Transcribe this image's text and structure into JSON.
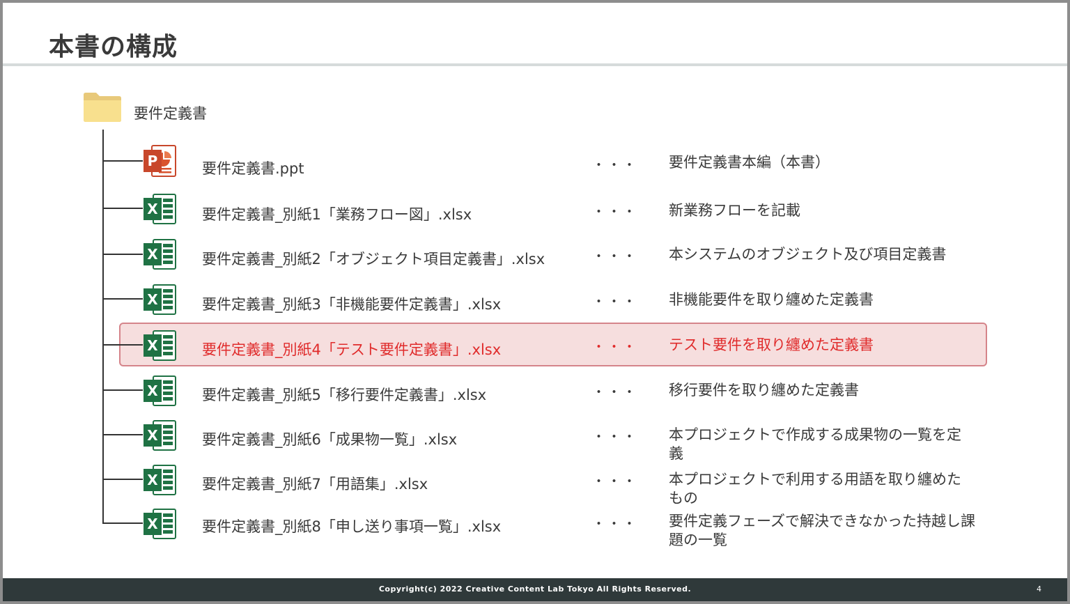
{
  "title": "本書の構成",
  "folder": {
    "label": "要件定義書",
    "icon": "folder-icon"
  },
  "files": [
    {
      "name": "要件定義書.ppt",
      "separator": "・・・",
      "desc": "要件定義書本編（本書）",
      "icon": "powerpoint-icon",
      "highlighted": false
    },
    {
      "name": "要件定義書_別紙1「業務フロー図」.xlsx",
      "separator": "・・・",
      "desc": "新業務フローを記載",
      "icon": "excel-icon",
      "highlighted": false
    },
    {
      "name": "要件定義書_別紙2「オブジェクト項目定義書」.xlsx",
      "separator": "・・・",
      "desc": "本システムのオブジェクト及び項目定義書",
      "icon": "excel-icon",
      "highlighted": false
    },
    {
      "name": "要件定義書_別紙3「非機能要件定義書」.xlsx",
      "separator": "・・・",
      "desc": "非機能要件を取り纏めた定義書",
      "icon": "excel-icon",
      "highlighted": false
    },
    {
      "name": "要件定義書_別紙4「テスト要件定義書」.xlsx",
      "separator": "・・・",
      "desc": "テスト要件を取り纏めた定義書",
      "icon": "excel-icon",
      "highlighted": true
    },
    {
      "name": "要件定義書_別紙5「移行要件定義書」.xlsx",
      "separator": "・・・",
      "desc": "移行要件を取り纏めた定義書",
      "icon": "excel-icon",
      "highlighted": false
    },
    {
      "name": "要件定義書_別紙6「成果物一覧」.xlsx",
      "separator": "・・・",
      "desc": "本プロジェクトで作成する成果物の一覧を定義",
      "icon": "excel-icon",
      "highlighted": false
    },
    {
      "name": "要件定義書_別紙7「用語集」.xlsx",
      "separator": "・・・",
      "desc": "本プロジェクトで利用する用語を取り纏めたもの",
      "icon": "excel-icon",
      "highlighted": false
    },
    {
      "name": "要件定義書_別紙8「申し送り事項一覧」.xlsx",
      "separator": "・・・",
      "desc": "要件定義フェーズで解決できなかった持越し課題の一覧",
      "icon": "excel-icon",
      "highlighted": false
    }
  ],
  "footer": {
    "copyright": "Copyright(c) 2022 Creative Content Lab Tokyo All Rights Reserved.",
    "page": "4"
  },
  "colors": {
    "highlight_text": "#e02b2b",
    "highlight_bg": "#f6dede",
    "highlight_border": "#d5848a",
    "footer_bg": "#2f393a"
  }
}
